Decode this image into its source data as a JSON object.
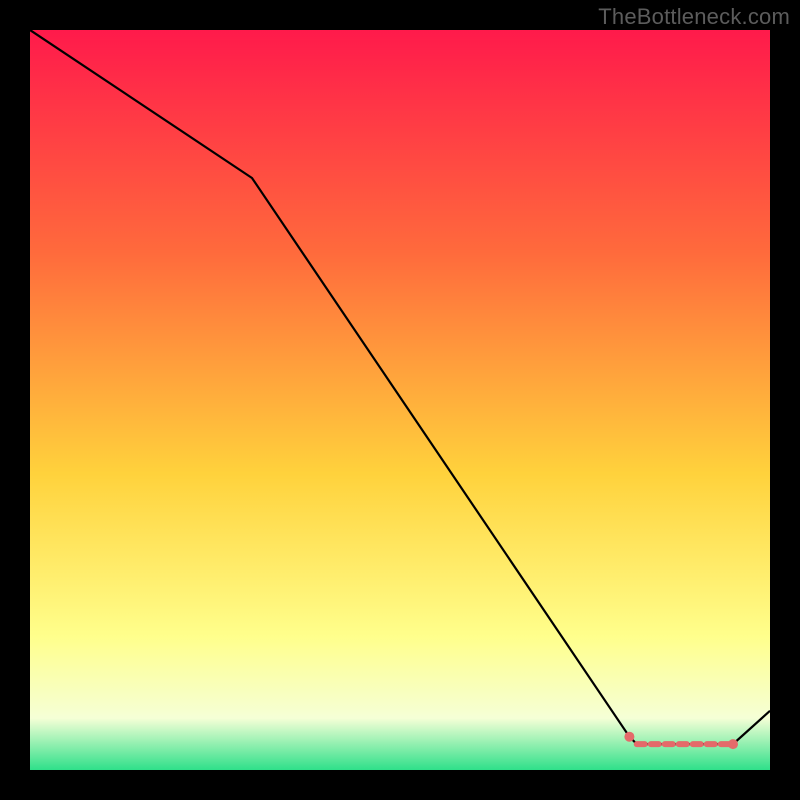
{
  "watermark": "TheBottleneck.com",
  "chart_data": {
    "type": "line",
    "title": "",
    "xlabel": "",
    "ylabel": "",
    "xlim": [
      0,
      100
    ],
    "ylim": [
      0,
      100
    ],
    "grid": false,
    "legend": false,
    "background_gradient": {
      "colors": [
        "#ff1a4b",
        "#ff6a3c",
        "#ffd23c",
        "#ffff8c",
        "#f5ffd6",
        "#2fe08a"
      ],
      "positions": [
        0.0,
        0.3,
        0.6,
        0.82,
        0.93,
        1.0
      ]
    },
    "series": [
      {
        "name": "curve",
        "color": "#000000",
        "stroke_width": 2.2,
        "x": [
          0,
          30,
          81,
          82,
          95,
          100
        ],
        "y": [
          100,
          80,
          4.5,
          3.5,
          3.5,
          8
        ]
      }
    ],
    "markers": [
      {
        "name": "segment-start",
        "x": 81,
        "y": 4.5,
        "r": 5,
        "color": "#e46a6a"
      },
      {
        "name": "segment-end",
        "x": 95,
        "y": 3.5,
        "r": 5,
        "color": "#e46a6a"
      }
    ],
    "dashed_segments": [
      {
        "name": "highlight-dashes",
        "color": "#e46a6a",
        "stroke_width": 6,
        "dash": "8 6",
        "x": [
          82,
          95
        ],
        "y": [
          3.5,
          3.5
        ]
      }
    ]
  }
}
